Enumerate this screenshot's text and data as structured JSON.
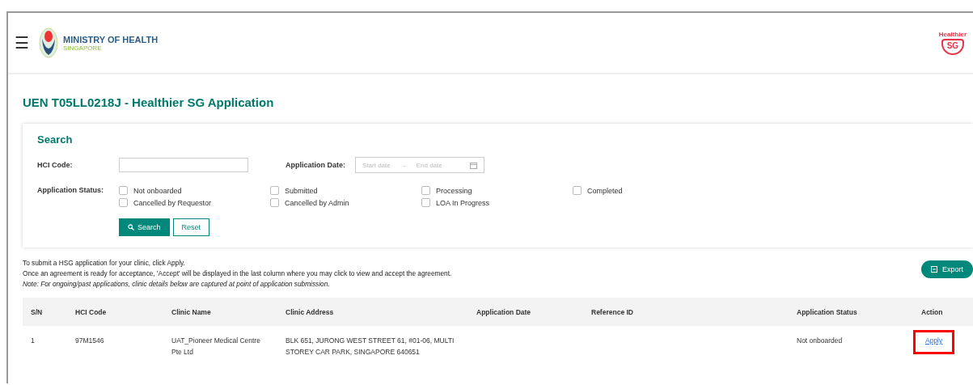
{
  "header": {
    "menu_icon": "☰",
    "org_name": "MINISTRY OF HEALTH",
    "org_sub": "SINGAPORE",
    "logo_right": {
      "top": "Healthier",
      "bottom": "SG"
    }
  },
  "page_title": "UEN T05LL0218J - Healthier SG Application",
  "search": {
    "title": "Search",
    "hci_code": {
      "label": "HCI Code:"
    },
    "application_date": {
      "label": "Application Date:",
      "start_placeholder": "Start date",
      "separator": "→",
      "end_placeholder": "End date"
    },
    "status_label": "Application Status:",
    "statuses": [
      {
        "label": "Not onboarded",
        "checked": false
      },
      {
        "label": "Submitted",
        "checked": false
      },
      {
        "label": "Processing",
        "checked": false
      },
      {
        "label": "Completed",
        "checked": false
      },
      {
        "label": "Cancelled by Requestor",
        "checked": false
      },
      {
        "label": "Cancelled by Admin",
        "checked": false
      },
      {
        "label": "LOA In Progress",
        "checked": false
      }
    ],
    "buttons": [
      {
        "label": "Search",
        "kind": "primary"
      },
      {
        "label": "Reset",
        "kind": "secondary"
      }
    ]
  },
  "notes": [
    {
      "text": "To submit a HSG application for your clinic, click Apply.",
      "kind": "plain"
    },
    {
      "text": "Once an agreement is ready for acceptance, 'Accept' will be displayed in the last column where you may click to view and accept the agreement.",
      "kind": "plain"
    },
    {
      "text": "Note: For ongoing/past applications, clinic details below are captured at point of application submission.",
      "kind": "italic"
    }
  ],
  "export_button": "Export",
  "table": {
    "columns": [
      "S/N",
      "HCI Code",
      "Clinic Name",
      "Clinic Address",
      "Application Date",
      "Reference ID",
      "Application Status",
      "Action"
    ],
    "rows": [
      {
        "sn": "1",
        "hci_code": "97M1546",
        "clinic_name": "UAT_Pioneer Medical Centre Pte Ltd",
        "clinic_address": "BLK 651, JURONG WEST STREET 61, #01-06, MULTI STOREY CAR PARK, SINGAPORE 640651",
        "status": "Not onboarded",
        "action": "Apply",
        "highlighted": true
      }
    ]
  }
}
